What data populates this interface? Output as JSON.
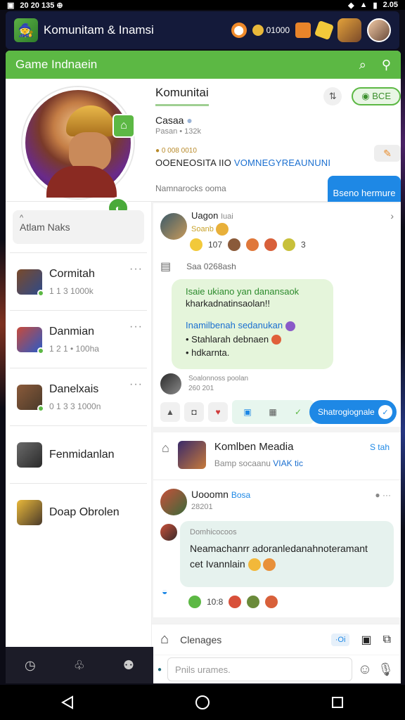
{
  "status_bar": {
    "time": "2.05",
    "left_text": "20 20 135 ⊕"
  },
  "header": {
    "title": "Komunitam & Inamsi",
    "coins": "01000",
    "colors": {
      "header_bg": "#141a3a",
      "accent_green": "#5cb844",
      "accent_blue": "#1e88e5"
    }
  },
  "section": {
    "title": "Game Indnaein"
  },
  "profile": {
    "community_title": "Komunitai",
    "join_label": "BCE",
    "name": "Casaa",
    "name_meta": "Pasan • 132k",
    "tiny_meta": "0 008 0010",
    "headline_a": "OOENEOSITA IIO",
    "headline_b": "VOMNEGYREAUNUNI",
    "cta_label": "Bseno hermure",
    "bottom_note": "Namnarocks ooma"
  },
  "sidebar": {
    "filter_label": "Atlam Naks",
    "items": [
      {
        "name": "Cormitah",
        "sub": "1 1 3 1000k"
      },
      {
        "name": "Danmian",
        "sub": "1 2 1 • 100ha"
      },
      {
        "name": "Danelxais",
        "sub": "0 1 3 3 1000n"
      },
      {
        "name": "Fenmidanlan",
        "sub": ""
      },
      {
        "name": "Doap Obrolen",
        "sub": ""
      }
    ]
  },
  "post": {
    "author": "Uagon",
    "author_tag": "Iuai",
    "sub_label": "Soanb",
    "reaction_count": "107",
    "reaction_tail": "3",
    "date_line": "Saa 0268ash",
    "bubble_l1": "Isaie ukiano yan danansaok",
    "bubble_l2": "kharkadnatinsaolan!!",
    "bubble_l3": "Inamilbenah sedanukan",
    "bubble_l4": "Stahlarah debnaen",
    "bubble_l5": "hdkarnta.",
    "commenter_name": "Soalonnoss poolan",
    "commenter_meta": "260 201",
    "pill_label": "Shatrogiognale"
  },
  "media": {
    "title": "Komlben Meadia",
    "sub_a": "Bamp socaanu",
    "sub_b": "VIAK tic",
    "tag": "S tah"
  },
  "chat": {
    "author": "Uooomn",
    "author_tag": "Bosa",
    "author_meta": "28201",
    "bubble_meta": "Domhicocoos",
    "bubble_msg_1": "Neamachanrr adoranledanahnoteramant",
    "bubble_msg_2": "cet Ivannlain",
    "react_count": "10:8"
  },
  "composer": {
    "label": "Clenages",
    "badge": "·Oi",
    "placeholder": "Pnils urames."
  }
}
